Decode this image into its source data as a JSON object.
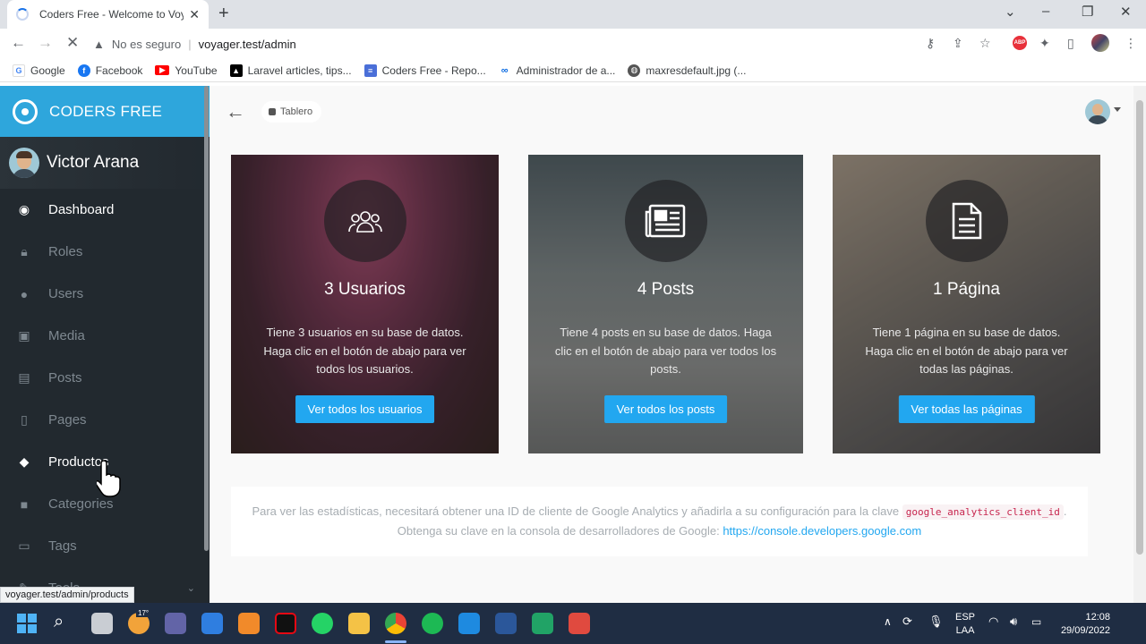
{
  "browser": {
    "tab_title": "Coders Free - Welcome to Voyager",
    "security_label": "No es seguro",
    "url": "voyager.test/admin",
    "bookmarks": [
      "Google",
      "Facebook",
      "YouTube",
      "Laravel articles, tips...",
      "Coders Free - Repo...",
      "Administrador de a...",
      "maxresdefault.jpg (..."
    ],
    "status_url": "voyager.test/admin/products"
  },
  "sidebar": {
    "brand": "CODERS FREE",
    "user_name": "Victor Arana",
    "items": [
      {
        "label": "Dashboard",
        "icon": "dashboard-icon"
      },
      {
        "label": "Roles",
        "icon": "lock-icon"
      },
      {
        "label": "Users",
        "icon": "user-icon"
      },
      {
        "label": "Media",
        "icon": "image-icon"
      },
      {
        "label": "Posts",
        "icon": "news-icon"
      },
      {
        "label": "Pages",
        "icon": "file-icon"
      },
      {
        "label": "Productos",
        "icon": "tag-icon"
      },
      {
        "label": "Categories",
        "icon": "folder-icon"
      },
      {
        "label": "Tags",
        "icon": "label-icon"
      },
      {
        "label": "Tools",
        "icon": "tools-icon"
      }
    ]
  },
  "header": {
    "breadcrumb": "Tablero"
  },
  "cards": [
    {
      "title": "3 Usuarios",
      "description": "Tiene 3 usuarios en su base de datos. Haga clic en el botón de abajo para ver todos los usuarios.",
      "button": "Ver todos los usuarios",
      "icon": "users-icon"
    },
    {
      "title": "4 Posts",
      "description": "Tiene 4 posts en su base de datos. Haga clic en el botón de abajo para ver todos los posts.",
      "button": "Ver todos los posts",
      "icon": "newspaper-icon"
    },
    {
      "title": "1 Página",
      "description": "Tiene 1 página en su base de datos. Haga clic en el botón de abajo para ver todas las páginas.",
      "button": "Ver todas las páginas",
      "icon": "document-icon"
    }
  ],
  "analytics": {
    "text_before": "Para ver las estadísticas, necesitará obtener una ID de cliente de Google Analytics y añadirla a su configuración para la clave",
    "key": "google_analytics_client_id",
    "text_after": ".",
    "line2": "Obtenga su clave en la consola de desarrolladores de Google:",
    "link": "https://console.developers.google.com"
  },
  "taskbar": {
    "weather_badge": "17°",
    "lang_1": "ESP",
    "lang_2": "LAA",
    "time": "12:08",
    "date": "29/09/2022"
  },
  "colors": {
    "brand": "#2ea6dc",
    "sidebar_bg": "#22292f",
    "button": "#22a7f0"
  }
}
